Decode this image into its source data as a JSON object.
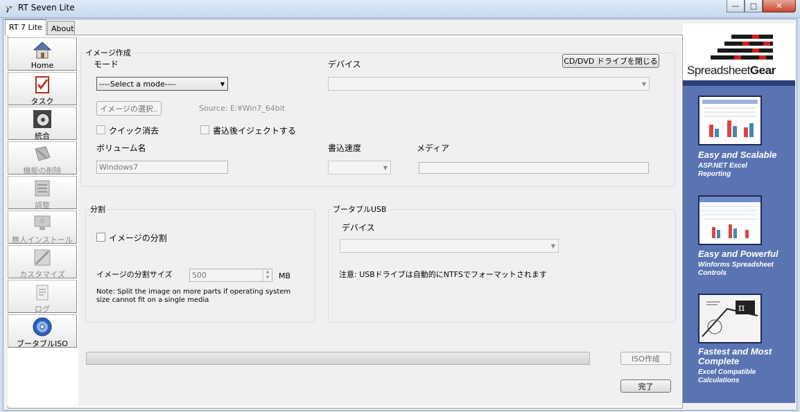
{
  "window": {
    "title": "RT Seven Lite",
    "min": "—",
    "max": "□",
    "close": "✕"
  },
  "tabs": [
    {
      "label": "RT 7 Lite"
    },
    {
      "label": "About"
    }
  ],
  "sidebar": {
    "items": [
      {
        "label": "Home",
        "icon": "home-icon"
      },
      {
        "label": "タスク",
        "icon": "task-icon"
      },
      {
        "label": "統合",
        "icon": "integrate-icon"
      },
      {
        "label": "機能の削除",
        "icon": "remove-features-icon"
      },
      {
        "label": "調整",
        "icon": "tweaks-icon"
      },
      {
        "label": "無人インストール",
        "icon": "unattended-icon"
      },
      {
        "label": "カスタマイズ",
        "icon": "customize-icon"
      },
      {
        "label": "ログ",
        "icon": "log-icon"
      },
      {
        "label": "ブータブルISO",
        "icon": "bootable-iso-icon"
      }
    ]
  },
  "image_creation": {
    "legend": "イメージ作成",
    "mode_label": "モード",
    "mode_value": "----Select a mode----",
    "device_label": "デバイス",
    "device_value": "",
    "close_drive_button": "CD/DVD ドライブを閉じる",
    "select_image_button": "イメージの選択..",
    "source_text": "Source: E:¥Win7_64bit",
    "quick_erase_label": "クイック消去",
    "eject_label": "書込後イジェクトする",
    "volume_label": "ボリューム名",
    "volume_value": "Windows7",
    "speed_label": "書込速度",
    "media_label": "メディア"
  },
  "split": {
    "legend": "分割",
    "split_checkbox_label": "イメージの分割",
    "size_label": "イメージの分割サイズ",
    "size_value": "500",
    "unit": "MB",
    "note": "Note: Split the image on more parts if operating system size cannot fit on a single media"
  },
  "usb": {
    "legend": "ブータブルUSB",
    "device_label": "デバイス",
    "notice": "注意: USBドライブは自動的にNTFSでフォーマットされます"
  },
  "footer": {
    "create_iso_button": "ISO作成",
    "done_button": "完了",
    "progress": 0
  },
  "ad": {
    "brand_part1": "Spreadsheet",
    "brand_part2": "Gear",
    "block1_title": "Easy and Scalable",
    "block1_sub": "ASP.NET Excel Reporting",
    "block2_title": "Easy and Powerful",
    "block2_sub": "Winforms Spreadsheet Controls",
    "block3_title": "Fastest and Most Complete",
    "block3_sub": "Excel Compatible Calculations"
  }
}
